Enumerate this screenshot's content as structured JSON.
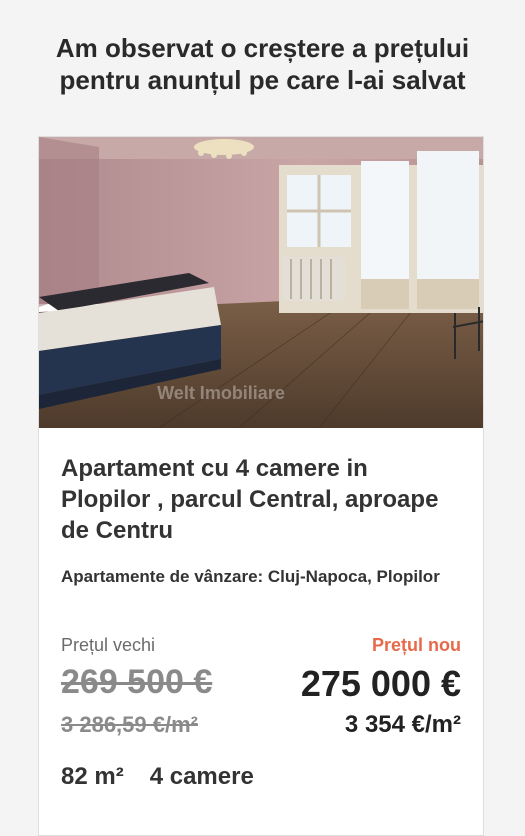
{
  "notification": {
    "headline": "Am observat o creștere a prețului pentru anunțul pe care l-ai salvat"
  },
  "listing": {
    "image_watermark": "Welt Imobiliare",
    "title": "Apartament cu 4 camere in Plopilor , parcul Central, aproape de Centru",
    "location": "Apartamente de vânzare: Cluj-Napoca, Plopilor",
    "old_price_label": "Prețul vechi",
    "new_price_label": "Prețul nou",
    "old_price": "269 500 €",
    "new_price": "275 000 €",
    "old_price_per_sqm": "3 286,59 €/m²",
    "new_price_per_sqm": "3 354 €/m²",
    "surface": "82 m²",
    "rooms": "4 camere"
  },
  "colors": {
    "new_price_label": "#e8694a",
    "old_price": "#8a8a8a",
    "background": "#f4f4f4"
  }
}
